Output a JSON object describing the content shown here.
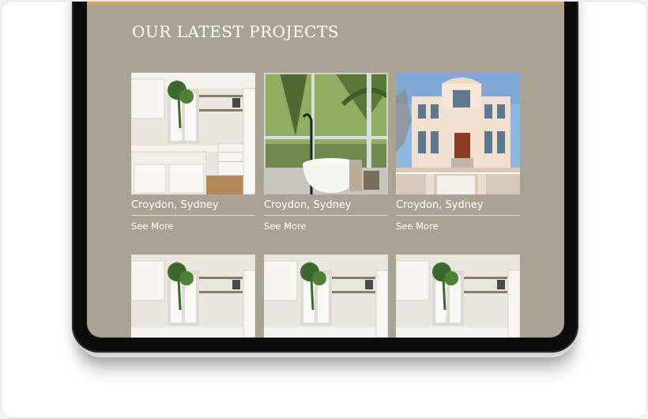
{
  "theme": {
    "accent": "#d9a25b",
    "screen_bg": "#aaa394",
    "text": "#ffffff"
  },
  "section": {
    "title": "OUR LATEST PROJECTS"
  },
  "projects": [
    {
      "title": "Croydon, Sydney",
      "link": "See More",
      "image": "kitchen-photo"
    },
    {
      "title": "Croydon, Sydney",
      "link": "See More",
      "image": "bathroom-photo"
    },
    {
      "title": "Croydon, Sydney",
      "link": "See More",
      "image": "house-exterior-photo"
    },
    {
      "image": "kitchen-photo"
    },
    {
      "image": "kitchen-photo"
    },
    {
      "image": "kitchen-photo"
    }
  ]
}
